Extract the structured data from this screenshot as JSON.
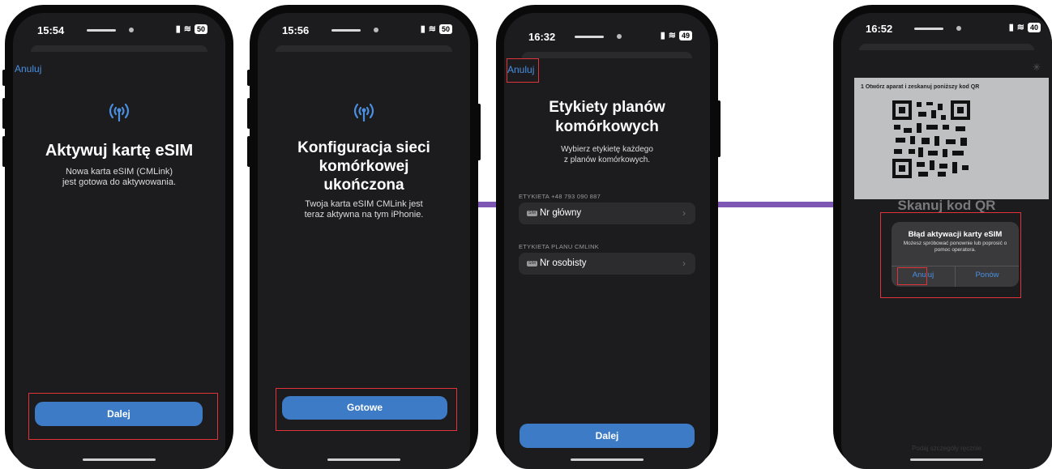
{
  "screens": [
    {
      "status": {
        "time": "15:54",
        "battery": "50"
      },
      "cancel_label": "Anuluj",
      "title": "Aktywuj kartę eSIM",
      "subtitle": "Nowa karta eSIM (CMLink)\njest gotowa do aktywowania.",
      "button_label": "Dalej"
    },
    {
      "status": {
        "time": "15:56",
        "battery": "50"
      },
      "title": "Konfiguracja sieci komórkowej ukończona",
      "subtitle": "Twoja karta eSIM CMLink jest\nteraz aktywna na tym iPhonie.",
      "button_label": "Gotowe"
    },
    {
      "status": {
        "time": "16:32",
        "battery": "49"
      },
      "cancel_label": "Anuluj",
      "title": "Etykiety planów komórkowych",
      "subtitle": "Wybierz etykietę każdego\nz planów komórkowych.",
      "sections": [
        {
          "header": "ETYKIETA +48 793 090 887",
          "value": "Nr główny"
        },
        {
          "header": "ETYKIETA PLANU CMLINK",
          "value": "Nr osobisty"
        }
      ],
      "button_label": "Dalej"
    },
    {
      "status": {
        "time": "16:52",
        "battery": "40"
      },
      "qr_instruction": "1   Otwórz aparat i zeskanuj poniższy kod QR",
      "scan_title": "Skanuj kod QR",
      "alert": {
        "title": "Błąd aktywacji karty eSIM",
        "message": "Możesz spróbować ponownie lub poprosić o pomoc operatora.",
        "cancel": "Anuluj",
        "retry": "Ponów"
      },
      "manual_entry": "Podaj szczegóły ręcznie"
    }
  ],
  "colors": {
    "accent": "#3d7bc6",
    "link": "#4a8fe0",
    "highlight": "#e0333a",
    "connector": "#7e57b5"
  }
}
